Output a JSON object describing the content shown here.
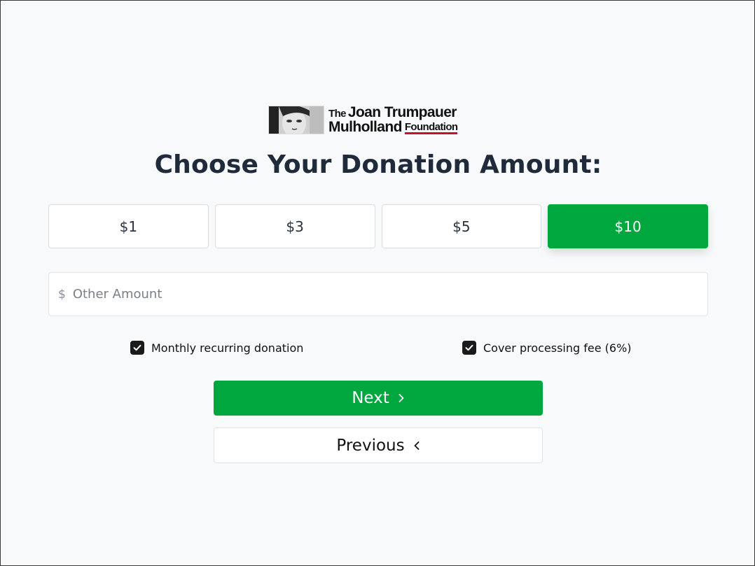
{
  "logo": {
    "line1_prefix": "The",
    "line1_main": "Joan Trumpauer",
    "line2_main": "Mulholland",
    "line2_suffix": "Foundation"
  },
  "title": "Choose Your Donation Amount:",
  "amounts": [
    {
      "label": "$1",
      "selected": false
    },
    {
      "label": "$3",
      "selected": false
    },
    {
      "label": "$5",
      "selected": false
    },
    {
      "label": "$10",
      "selected": true
    }
  ],
  "other_amount": {
    "currency_symbol": "$",
    "placeholder": "Other Amount",
    "value": ""
  },
  "options": {
    "monthly": {
      "label": "Monthly recurring donation",
      "checked": true
    },
    "fee": {
      "label": "Cover processing fee (6%)",
      "checked": true
    }
  },
  "buttons": {
    "next": {
      "label": "Next",
      "icon": "chevron-right-icon"
    },
    "previous": {
      "label": "Previous",
      "icon": "chevron-left-icon"
    }
  },
  "colors": {
    "accent": "#00a73e",
    "brand_underline": "#c8102e",
    "checkbox": "#1a1a1a"
  }
}
